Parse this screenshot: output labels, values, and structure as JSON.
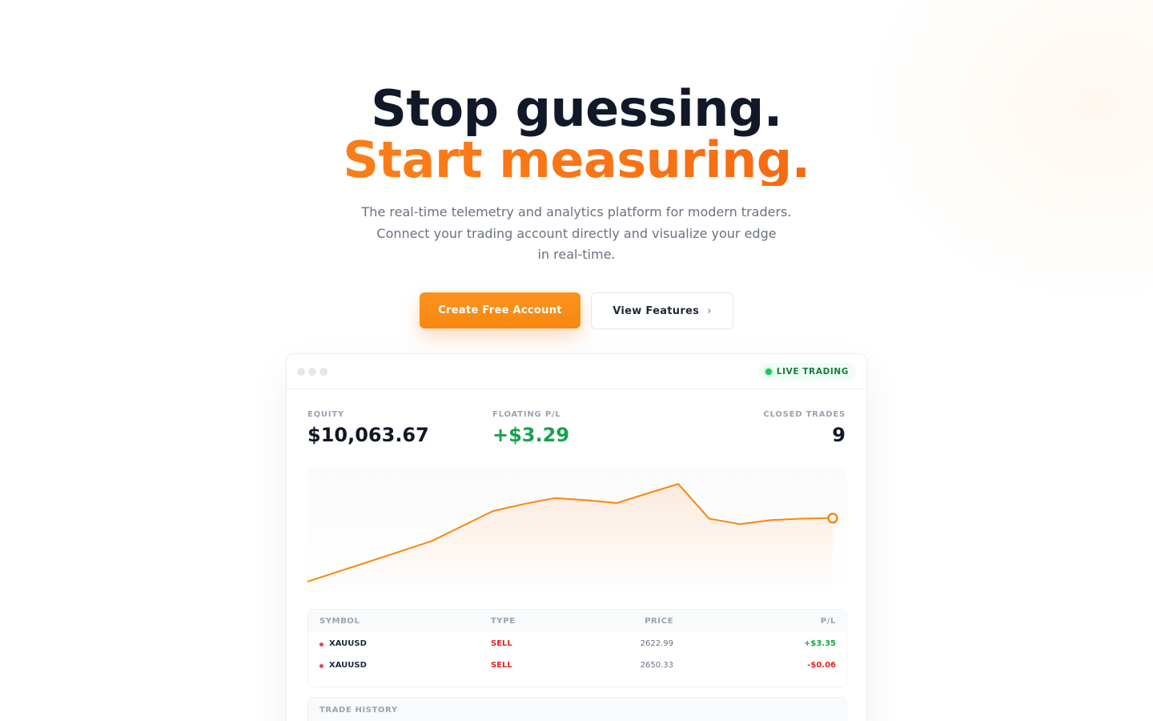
{
  "hero": {
    "headline_line1": "Stop guessing.",
    "headline_line2": "Start measuring.",
    "subtitle_lines": [
      "The real-time telemetry and analytics platform for modern traders.",
      "Connect your trading account directly and visualize your edge",
      "in real-time."
    ],
    "primary_cta": "Create Free Account",
    "secondary_cta": "View Features",
    "secondary_cta_icon": "chevron-right-icon"
  },
  "dashboard": {
    "status_badge": "LIVE TRADING",
    "stats": {
      "equity_label": "EQUITY",
      "equity_value": "$10,063.67",
      "floating_label": "FLOATING P/L",
      "floating_value": "+$3.29",
      "closed_label": "CLOSED TRADES",
      "closed_value": "9"
    },
    "table": {
      "headers": [
        "SYMBOL",
        "TYPE",
        "PRICE",
        "P/L"
      ],
      "rows": [
        {
          "symbol": "XAUUSD",
          "type": "SELL",
          "price": "2622.99",
          "pl": "+$3.35"
        },
        {
          "symbol": "XAUUSD",
          "type": "SELL",
          "price": "2650.33",
          "pl": "-$0.06"
        }
      ]
    },
    "history_title": "TRADE HISTORY"
  },
  "colors": {
    "accent": "#f7870f",
    "positive": "#16a34a",
    "negative": "#dc2626",
    "text_dark": "#111827",
    "muted": "#9ca3af"
  },
  "chart_data": {
    "type": "area",
    "x": [
      0,
      1,
      2,
      3,
      4,
      5,
      6,
      7,
      8,
      9,
      10,
      11,
      12,
      13,
      14,
      15,
      16,
      17
    ],
    "values": [
      0,
      2,
      4,
      6,
      8,
      11,
      14,
      15.4,
      16.6,
      16.2,
      15.6,
      17.5,
      19.4,
      12.5,
      11.4,
      12.2,
      12.5,
      12.6
    ],
    "title": "",
    "xlabel": "",
    "ylabel": "",
    "ylim": [
      0,
      21
    ],
    "grid": false,
    "legend": "none",
    "last_point_marker": true
  }
}
